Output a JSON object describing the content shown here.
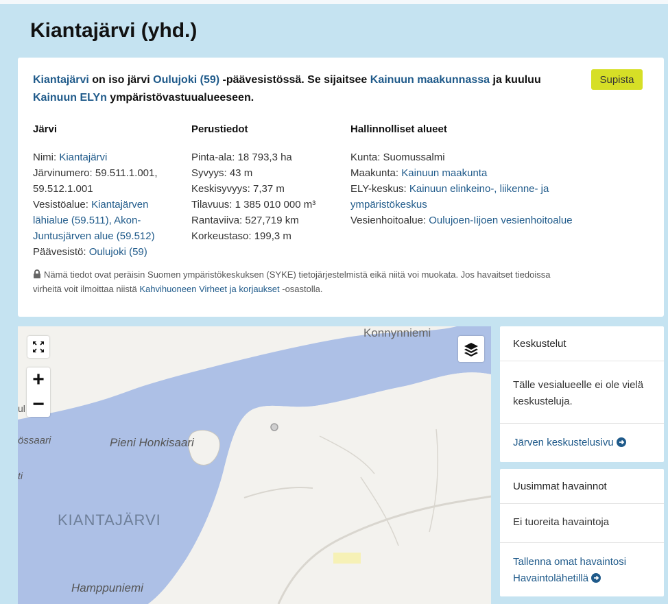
{
  "title": "Kiantajärvi (yhd.)",
  "intro": {
    "lake_link": "Kiantajärvi",
    "t1": " on iso järvi ",
    "basin_link": "Oulujoki (59)",
    "t2": " -päävesistössä. Se sijaitsee ",
    "region_link": "Kainuun maakunnassa",
    "t3": " ja kuuluu ",
    "ely_link": "Kainuun ELYn",
    "t4": " ympäristövastuualueeseen."
  },
  "collapse_button": "Supista",
  "lake": {
    "heading": "Järvi",
    "name_label": "Nimi: ",
    "name_value": "Kiantajärvi",
    "number_label": "Järvinumero: ",
    "number_value1": "59.511.1.001,",
    "number_value2": "59.512.1.001",
    "area_label": "Vesistöalue: ",
    "area_link1": "Kiantajärven",
    "area_link2": "lähialue (59.511),",
    "area_link3": " Akon-",
    "area_link4": "Juntusjärven alue (59.512)",
    "basin_label": "Päävesistö: ",
    "basin_link": "Oulujoki (59)"
  },
  "basic": {
    "heading": "Perustiedot",
    "rows": [
      "Pinta-ala: 18 793,3 ha",
      "Syvyys: 43 m",
      "Keskisyvyys: 7,37 m",
      "Tilavuus: 1 385 010 000 m³",
      "Rantaviiva: 527,719 km",
      "Korkeustaso: 199,3 m"
    ]
  },
  "admin": {
    "heading": "Hallinnolliset alueet",
    "municipality": "Kunta: Suomussalmi",
    "region_label": "Maakunta: ",
    "region_link": "Kainuun maakunta",
    "ely_label": "ELY-keskus: ",
    "ely_link1": "Kainuun elinkeino-, liikenne- ja",
    "ely_link2": "ympäristökeskus",
    "water_label": "Vesienhoitoalue: ",
    "water_link": "Oulujoen-Iijoen vesienhoitoalue"
  },
  "notice": {
    "text1": "Nämä tiedot ovat peräisin Suomen ympäristökeskuksen (SYKE) tietojärjestelmistä eikä niitä voi muokata. Jos havaitset tiedoissa",
    "text2": "virheitä voit ilmoittaa niistä ",
    "link": "Kahvihuoneen Virheet ja korjaukset",
    "text3": " -osastolla."
  },
  "map": {
    "labels": {
      "top": "Konnynniemi",
      "island": "Pieni Honkisaari",
      "left1": "össaari",
      "left2": "ti",
      "left3": "ul",
      "lake": "KIANTAJÄRVI",
      "bottom": "Hamppuniemi"
    },
    "zoom_in": "+",
    "zoom_out": "−",
    "colors": {
      "water": "#adc0e6",
      "land": "#f3f2ee",
      "road": "#d9d6cf"
    }
  },
  "discussions": {
    "heading": "Keskustelut",
    "body": "Tälle vesialueelle ei ole vielä keskusteluja.",
    "link": "Järven keskustelusivu"
  },
  "observations": {
    "heading": "Uusimmat havainnot",
    "body": "Ei tuoreita havaintoja",
    "link1": "Tallenna omat havaintosi",
    "link2": "Havaintolähetillä"
  }
}
